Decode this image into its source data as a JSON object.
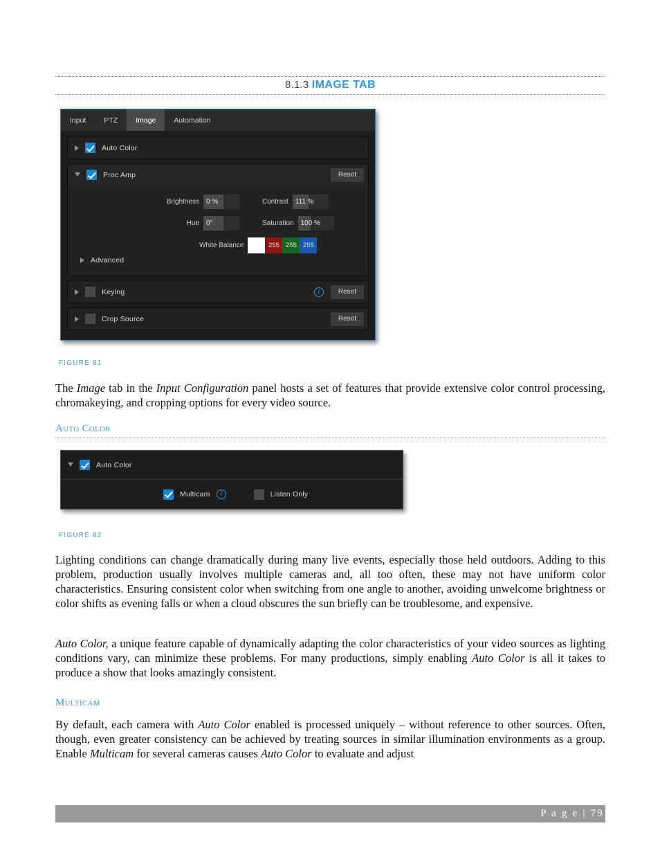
{
  "heading": {
    "number": "8.1.3",
    "title": "IMAGE TAB"
  },
  "figure81": {
    "tabs": [
      {
        "label": "Input",
        "active": false
      },
      {
        "label": "PTZ",
        "active": false
      },
      {
        "label": "Image",
        "active": true
      },
      {
        "label": "Automation",
        "active": false
      }
    ],
    "sections": {
      "auto_color": {
        "label": "Auto Color",
        "checked": true,
        "expanded": false
      },
      "proc_amp": {
        "label": "Proc Amp",
        "checked": true,
        "expanded": true,
        "reset_label": "Reset"
      },
      "advanced": {
        "label": "Advanced",
        "expanded": false
      },
      "keying": {
        "label": "Keying",
        "checked": false,
        "expanded": false,
        "reset_label": "Reset",
        "info_glyph": "i"
      },
      "crop_source": {
        "label": "Crop Source",
        "checked": false,
        "expanded": false,
        "reset_label": "Reset"
      }
    },
    "proc_amp_controls": {
      "brightness": {
        "label": "Brightness",
        "value": "0  %",
        "fill_pct": 56
      },
      "contrast": {
        "label": "Contrast",
        "value": "111  %",
        "fill_pct": 45
      },
      "hue": {
        "label": "Hue",
        "value": "0°",
        "fill_pct": 56
      },
      "saturation": {
        "label": "Saturation",
        "value": "100  %",
        "fill_pct": 36
      },
      "white_balance": {
        "label": "White Balance",
        "swatches": [
          {
            "name": "white",
            "value": "",
            "color": "#ffffff"
          },
          {
            "name": "red",
            "value": "255",
            "color": "#8f1515"
          },
          {
            "name": "green",
            "value": "255",
            "color": "#17661f"
          },
          {
            "name": "blue",
            "value": "255",
            "color": "#1558b5"
          }
        ]
      }
    }
  },
  "figure81_caption": "FIGURE 81",
  "para1": {
    "seg1": "The ",
    "em1": "Image",
    "seg2": " tab in the ",
    "em2": "Input Configuration",
    "seg3": " panel hosts a set of features that provide extensive color control processing, chromakeying, and cropping options for every video source."
  },
  "subhead_auto_color": "Auto Color",
  "figure82": {
    "header": {
      "label": "Auto Color",
      "checked": true,
      "expanded": true
    },
    "options": [
      {
        "label": "Multicam",
        "checked": true,
        "info_glyph": "i"
      },
      {
        "label": "Listen Only",
        "checked": false
      }
    ]
  },
  "figure82_caption": "FIGURE 82",
  "para2": "Lighting conditions can change dramatically during many live events, especially those held outdoors. Adding to this problem, production usually involves multiple cameras and, all too often, these may not have uniform color characteristics. Ensuring consistent color when switching from one angle to another, avoiding unwelcome brightness or color shifts as evening falls or when a cloud obscures the sun briefly can be troublesome, and expensive.",
  "para3": {
    "em1": "Auto Color,",
    "seg1": " a unique feature capable of dynamically adapting the color characteristics of your video sources as lighting conditions vary, can minimize these problems.  For many productions, simply enabling ",
    "em2": "Auto Color",
    "seg2": " is all it takes to produce a show that looks amazingly consistent."
  },
  "subhead_multicam": "Multicam",
  "para4": {
    "seg1": "By default, each camera with ",
    "em1": "Auto Color",
    "seg2": " enabled is processed uniquely – without reference to other sources. Often, though, even greater consistency can be achieved by treating sources in similar illumination environments as a group.  Enable ",
    "em2": "Multicam",
    "seg3": " for several cameras causes ",
    "em3": "Auto Color",
    "seg4": " to evaluate and adjust"
  },
  "footer": {
    "text": "P a g e  | 79"
  }
}
